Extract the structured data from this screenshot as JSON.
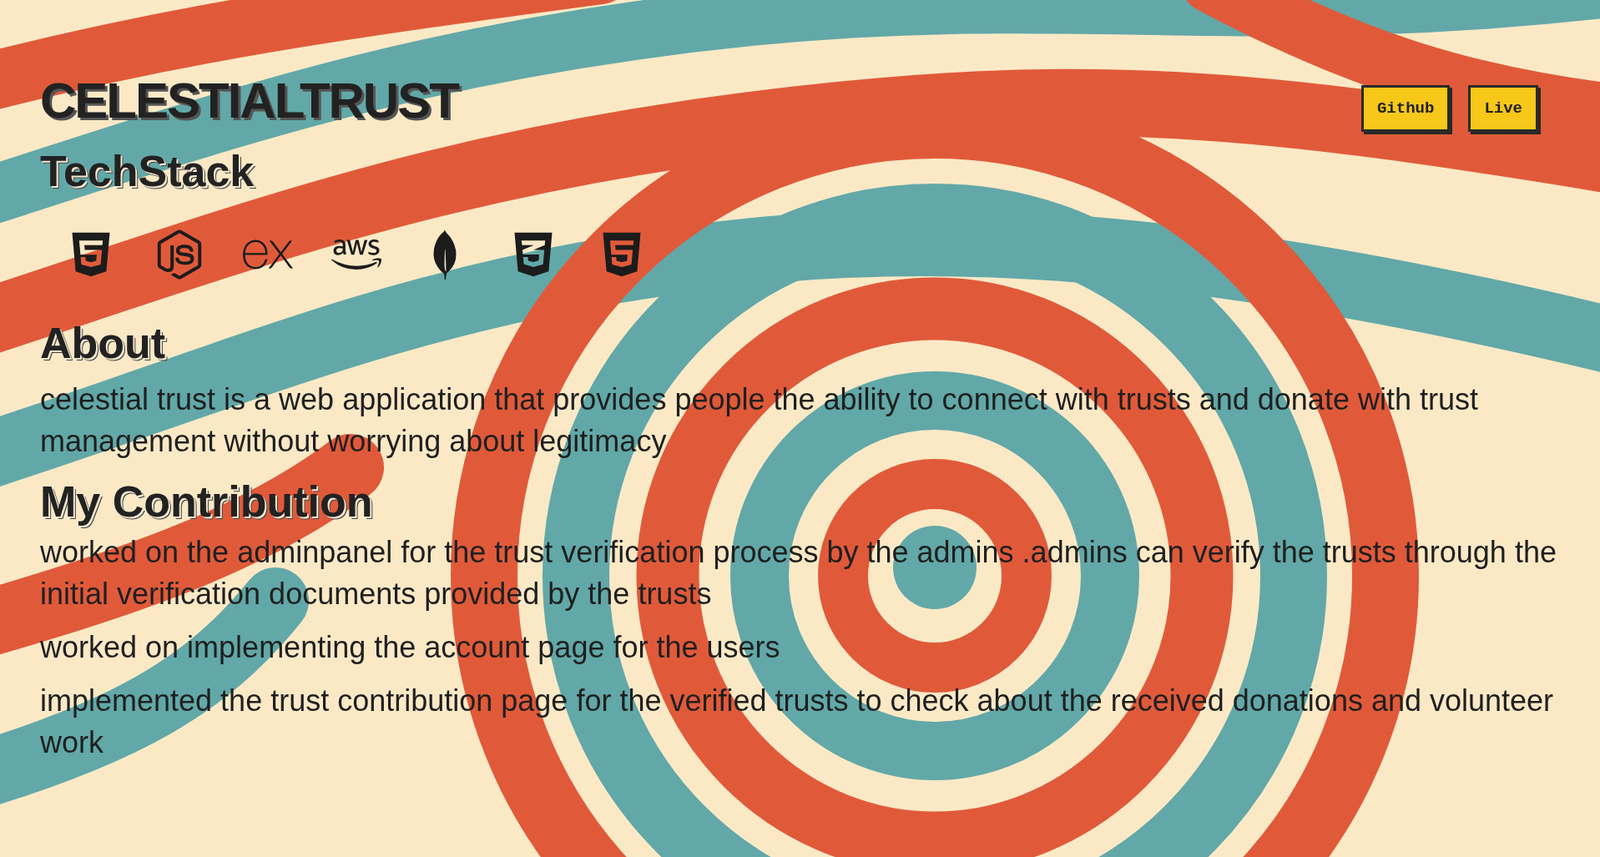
{
  "project": {
    "title": "CELESTIALTRUST",
    "links": [
      "Github",
      "Live"
    ]
  },
  "techstack": {
    "title": "TechStack",
    "items": [
      {
        "kind": "html5"
      },
      {
        "kind": "nodejs"
      },
      {
        "kind": "express"
      },
      {
        "kind": "aws"
      },
      {
        "kind": "mongodb"
      },
      {
        "kind": "css3"
      },
      {
        "kind": "html5"
      }
    ]
  },
  "about": {
    "title": "About",
    "text": "celestial trust is a web application that provides people the ability to connect with trusts and donate with trust management without worrying about legitimacy"
  },
  "contribution": {
    "title": "My Contribution",
    "items": [
      "worked on the adminpanel for the trust verification process by the admins .admins can verify the trusts through the initial verification documents provided by the trusts",
      "worked on implementing the account page for the users",
      "implemented the trust contribution page for the verified trusts to check about the received donations and volunteer work"
    ]
  }
}
